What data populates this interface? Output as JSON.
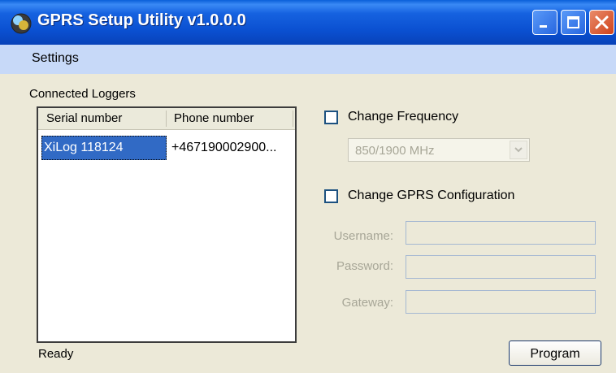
{
  "window": {
    "title": "GPRS Setup Utility v1.0.0.0",
    "app_icon": "app-globe-icon",
    "controls": [
      "minimize-icon",
      "maximize-icon",
      "close-icon"
    ]
  },
  "menu": {
    "items": [
      "Settings"
    ]
  },
  "loggers": {
    "group_label": "Connected Loggers",
    "columns": [
      "Serial number",
      "Phone number"
    ],
    "rows": [
      {
        "serial": "XiLog 118124",
        "phone": "+467190002900...",
        "selected": true
      }
    ]
  },
  "frequency": {
    "checkbox_label": "Change Frequency",
    "checked": false,
    "selected_option": "850/1900 MHz",
    "enabled": false
  },
  "gprs": {
    "checkbox_label": "Change GPRS Configuration",
    "checked": false,
    "username_label": "Username:",
    "password_label": "Password:",
    "gateway_label": "Gateway:",
    "username_value": "",
    "password_value": "",
    "gateway_value": "",
    "enabled": false
  },
  "status": {
    "text": "Ready"
  },
  "actions": {
    "program_label": "Program"
  },
  "colors": {
    "titlebar": "#0a4fd0",
    "menubar": "#c7d9f8",
    "window_bg": "#ece9d8",
    "selection": "#316ac5",
    "close_button": "#d0421a"
  }
}
